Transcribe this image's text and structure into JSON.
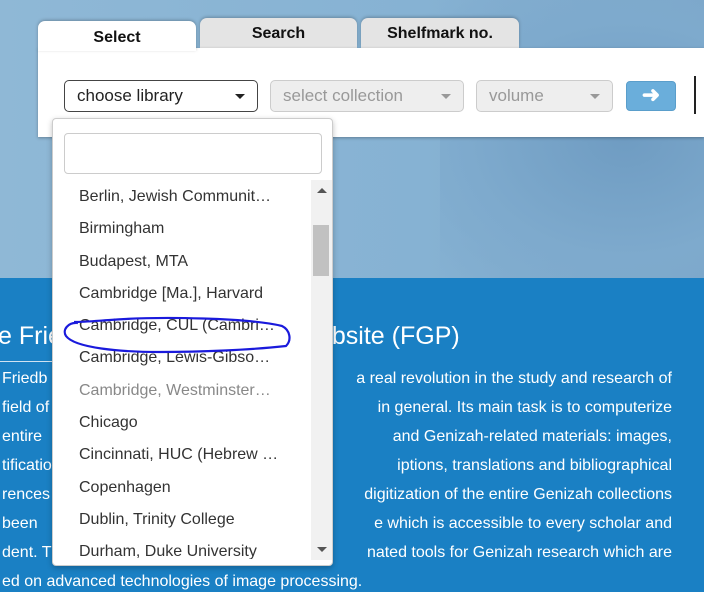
{
  "tabs": [
    {
      "label": "Select"
    },
    {
      "label": "Search"
    },
    {
      "label": "Shelfmark no."
    }
  ],
  "selects": {
    "library": "choose library",
    "collection": "select collection",
    "volume": "volume"
  },
  "go_icon": "arrow-right-icon",
  "go_symbol": "➜",
  "dropdown": {
    "search_value": "",
    "items": [
      "Berlin, Jewish Communit…",
      "Birmingham",
      "Budapest, MTA",
      "Cambridge [Ma.], Harvard",
      "Cambridge, CUL (Cambri…",
      "Cambridge, Lewis-Gibso…",
      "Cambridge, Westminster…",
      "Chicago",
      "Cincinnati, HUC (Hebrew …",
      "Copenhagen",
      "Dublin, Trinity College",
      "Durham, Duke University"
    ],
    "highlighted": "Cambridge, CUL (Cambri…"
  },
  "annotation_color": "#1a1adc",
  "content": {
    "heading_left": "e Frie",
    "heading_right": "ebsite (FGP)",
    "lines_left": [
      "Friedb",
      "field of",
      "entire",
      "tificatio",
      "rences",
      "been",
      "dent. Th",
      "ed on advanced technologies of image processing."
    ],
    "lines_right": [
      "a real revolution in the study and research of",
      "in general. Its main task is to computerize",
      "and Genizah-related materials: images,",
      "iptions, translations and bibliographical",
      "digitization of the entire Genizah collections",
      "e which is accessible to every scholar and",
      "nated tools for Genizah research which are"
    ]
  }
}
